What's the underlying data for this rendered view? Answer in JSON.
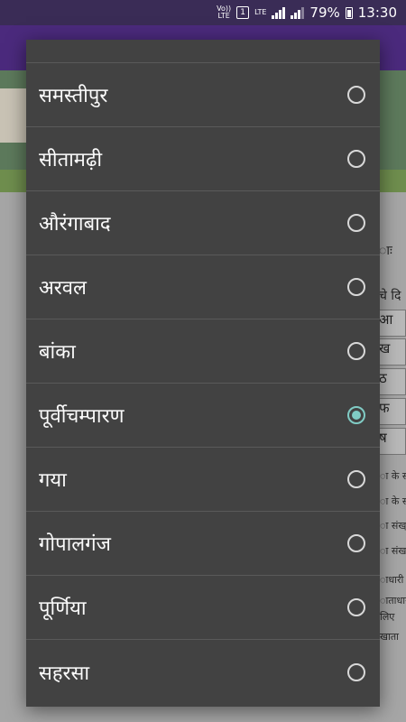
{
  "status_bar": {
    "volte": "Vo))",
    "lte_label": "LTE",
    "sim_slot": "1",
    "lte2": "LTE",
    "battery_percent": "79%",
    "time": "13:30"
  },
  "background": {
    "row_texts": [
      "ा के स",
      "ा के स",
      "ा संख्",
      "ा संख",
      "ाधारी",
      "ाताधारी",
      "लिए",
      "खाता"
    ],
    "cells": [
      "आ",
      "ख",
      "ठ",
      "फ",
      "ष"
    ],
    "label_a": "ाः",
    "label_b": "चे दि"
  },
  "dialog": {
    "options": [
      {
        "label": "",
        "selected": false
      },
      {
        "label": "समस्तीपुर",
        "selected": false
      },
      {
        "label": "सीतामढ़ी",
        "selected": false
      },
      {
        "label": "औरंगाबाद",
        "selected": false
      },
      {
        "label": "अरवल",
        "selected": false
      },
      {
        "label": "बांका",
        "selected": false
      },
      {
        "label": "पूर्वीचम्पारण",
        "selected": true
      },
      {
        "label": "गया",
        "selected": false
      },
      {
        "label": "गोपालगंज",
        "selected": false
      },
      {
        "label": "पूर्णिया",
        "selected": false
      },
      {
        "label": "सहरसा",
        "selected": false
      }
    ]
  },
  "colors": {
    "status_bar": "#3a2c56",
    "dialog_bg": "#424242",
    "accent": "#80cbc4"
  }
}
